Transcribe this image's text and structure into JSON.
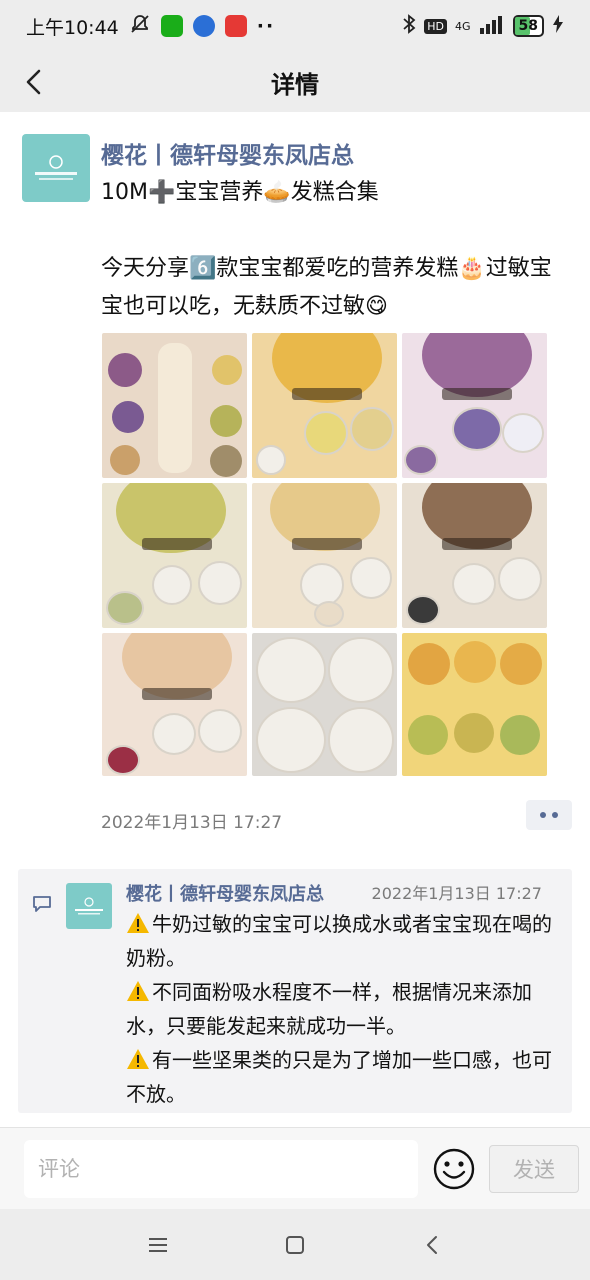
{
  "status_bar": {
    "time": "上午10:44",
    "network": "4G",
    "battery": "58",
    "battery_level": 0.58,
    "hd_label": "HD"
  },
  "header": {
    "title": "详情"
  },
  "post": {
    "author": "樱花丨德轩母婴东凤店总",
    "text_line1": "10M➕宝宝营养🥧发糕合集",
    "text_body": "今天分享6️⃣款宝宝都爱吃的营养发糕🎂过敏宝宝也可以吃，无麸质不过敏😋",
    "time": "2022年1月13日 17:27",
    "photo_count": 9
  },
  "comment": {
    "author": "樱花丨德轩母婴东凤店总",
    "time": "2022年1月13日 17:27",
    "lines": [
      "牛奶过敏的宝宝可以换成水或者宝宝现在喝的奶粉。",
      "不同面粉吸水程度不一样，根据情况来添加水，只要能发起来就成功一半。",
      "有一些坚果类的只是为了增加一些口感，也可不放。"
    ]
  },
  "input_bar": {
    "placeholder": "评论",
    "send_label": "发送"
  },
  "colors": {
    "link": "#576b95",
    "avatar_bg": "#7ecbc8",
    "bar_bg": "#ededed"
  }
}
